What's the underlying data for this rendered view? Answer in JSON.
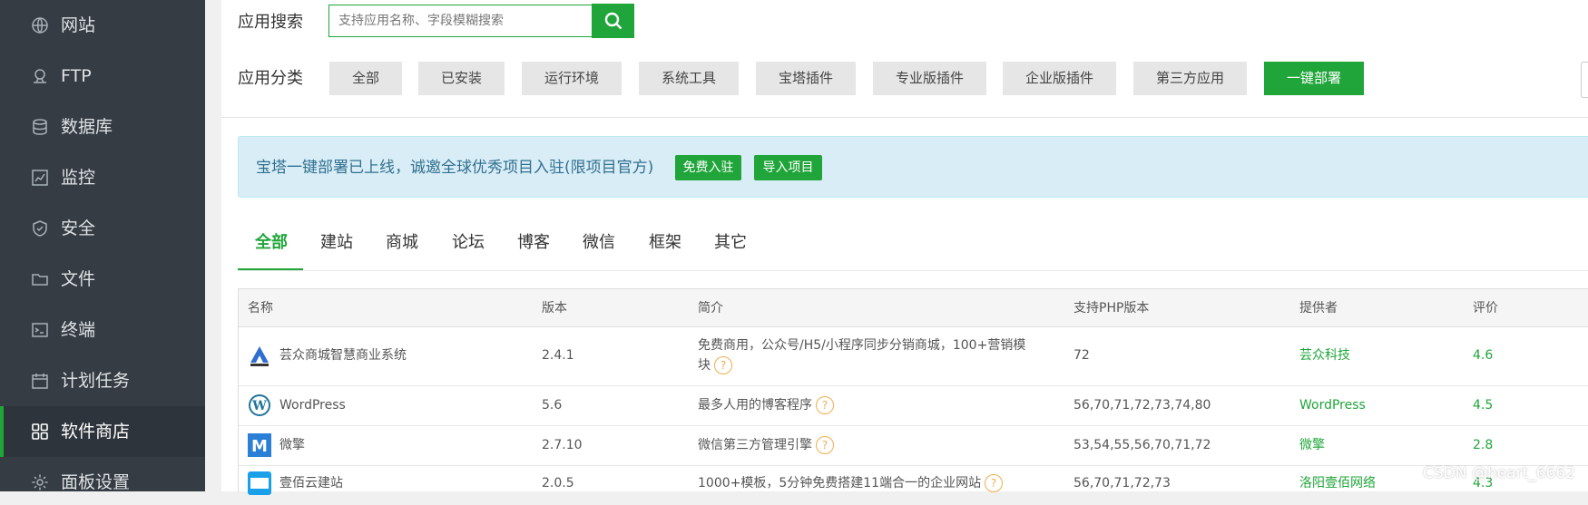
{
  "sidebar": {
    "items": [
      {
        "label": "网站",
        "icon": "globe-icon"
      },
      {
        "label": "FTP",
        "icon": "ftp-icon"
      },
      {
        "label": "数据库",
        "icon": "database-icon"
      },
      {
        "label": "监控",
        "icon": "monitor-icon"
      },
      {
        "label": "安全",
        "icon": "shield-icon"
      },
      {
        "label": "文件",
        "icon": "folder-icon"
      },
      {
        "label": "终端",
        "icon": "terminal-icon"
      },
      {
        "label": "计划任务",
        "icon": "calendar-icon"
      },
      {
        "label": "软件商店",
        "icon": "grid-icon",
        "active": true
      },
      {
        "label": "面板设置",
        "icon": "gear-icon"
      }
    ]
  },
  "search": {
    "label": "应用搜索",
    "placeholder": "支持应用名称、字段模糊搜索"
  },
  "category": {
    "label": "应用分类",
    "buttons": [
      "全部",
      "已安装",
      "运行环境",
      "系统工具",
      "宝塔插件",
      "专业版插件",
      "企业版插件",
      "第三方应用",
      "一键部署"
    ]
  },
  "banner": {
    "text": "宝塔一键部署已上线，诚邀全球优秀项目入驻(限项目官方)",
    "btn_free": "免费入驻",
    "btn_import": "导入项目"
  },
  "tabs": [
    "全部",
    "建站",
    "商城",
    "论坛",
    "博客",
    "微信",
    "框架",
    "其它"
  ],
  "table": {
    "headers": [
      "名称",
      "版本",
      "简介",
      "支持PHP版本",
      "提供者",
      "评价"
    ],
    "rows": [
      {
        "name": "芸众商城智慧商业系统",
        "version": "2.4.1",
        "desc_line1": "免费商用，公众号/H5/小程序同步分销商城，100+营销模",
        "desc_line2": "块",
        "php": "72",
        "provider": "芸众科技",
        "rating": "4.6"
      },
      {
        "name": "WordPress",
        "version": "5.6",
        "desc_line1": "最多人用的博客程序",
        "desc_line2": "",
        "php": "56,70,71,72,73,74,80",
        "provider": "WordPress",
        "rating": "4.5"
      },
      {
        "name": "微擎",
        "version": "2.7.10",
        "desc_line1": "微信第三方管理引擎",
        "desc_line2": "",
        "php": "53,54,55,56,70,71,72",
        "provider": "微擎",
        "rating": "2.8"
      },
      {
        "name": "壹佰云建站",
        "version": "2.0.5",
        "desc_line1": "1000+模板，5分钟免费搭建11端合一的企业网站",
        "desc_line2": "",
        "php": "56,70,71,72,73",
        "provider": "洛阳壹佰网络",
        "rating": "4.3"
      }
    ],
    "help_glyph": "?"
  },
  "watermark": "CSDN @heart_6662",
  "colors": {
    "accent": "#20a53a",
    "sidebar": "#353c44",
    "help": "#f0ad4e"
  }
}
